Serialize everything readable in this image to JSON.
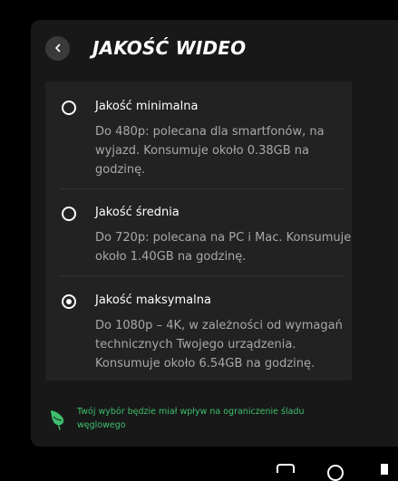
{
  "header": {
    "title": "JAKOŚĆ WIDEO",
    "back_icon": "chevron-left-icon"
  },
  "options": [
    {
      "title": "Jakość minimalna",
      "description": "Do 480p: polecana dla smartfonów, na wyjazd. Konsumuje około 0.38GB na godzinę.",
      "selected": false
    },
    {
      "title": "Jakość średnia",
      "description": "Do 720p: polecana na PC i Mac. Konsumuje około 1.40GB na godzinę.",
      "selected": false
    },
    {
      "title": "Jakość maksymalna",
      "description": "Do 1080p – 4K, w zależności od wymagań technicznych Twojego urządzenia. Konsumuje około 6.54GB na godzinę.",
      "selected": true
    }
  ],
  "footer": {
    "note": "Twój wybór będzie miał wpływ na ograniczenie śladu węglowego",
    "icon": "leaf-icon"
  },
  "colors": {
    "background": "#000000",
    "panel": "#181818",
    "options_box": "#222222",
    "accent_green": "#3dbf6e",
    "text_primary": "#ffffff",
    "text_secondary": "#a8a8a8"
  }
}
